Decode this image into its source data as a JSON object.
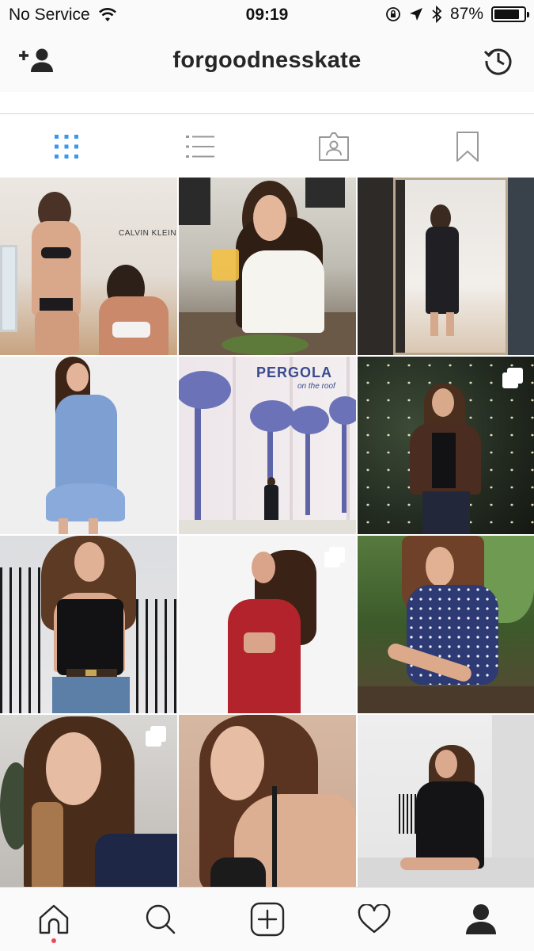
{
  "status_bar": {
    "carrier": "No Service",
    "time": "09:19",
    "battery_percent": "87%",
    "battery_level": 0.87,
    "icons": [
      "wifi-icon",
      "orientation-lock-icon",
      "location-arrow-icon",
      "bluetooth-icon",
      "battery-icon"
    ]
  },
  "header": {
    "username": "forgoodnesskate",
    "left_icon": "add-user-icon",
    "right_icon": "archive-history-icon"
  },
  "view_tabs": [
    {
      "id": "grid",
      "icon": "grid-icon",
      "active": true
    },
    {
      "id": "list",
      "icon": "list-icon",
      "active": false
    },
    {
      "id": "tagged",
      "icon": "tagged-photos-icon",
      "active": false
    },
    {
      "id": "saved",
      "icon": "bookmark-icon",
      "active": false
    }
  ],
  "posts": [
    {
      "scene": "two women in swimwear, Calvin Klein",
      "wall_text": "CALVIN KLEIN",
      "multi": false
    },
    {
      "scene": "woman at cafe with juice",
      "multi": false
    },
    {
      "scene": "mirror selfie in shop",
      "multi": false
    },
    {
      "scene": "blue polka dot wrap dress",
      "multi": false
    },
    {
      "scene": "palm tree mural wall",
      "wall_text": "PERGOLA",
      "wall_subtext": "on the roof",
      "multi": false
    },
    {
      "scene": "leather jacket with fairy lights",
      "multi": true
    },
    {
      "scene": "black cami and jeans",
      "multi": false
    },
    {
      "scene": "red dress over shoulder",
      "multi": true
    },
    {
      "scene": "navy floral wrap dress",
      "multi": false
    },
    {
      "scene": "close-up portrait",
      "multi": true
    },
    {
      "scene": "lace bralette portrait",
      "multi": false
    },
    {
      "scene": "black fringe jacket on steps",
      "multi": false
    }
  ],
  "bottom_nav": [
    {
      "id": "home",
      "icon": "home-icon",
      "active": true,
      "has_notification_dot": true
    },
    {
      "id": "search",
      "icon": "search-icon",
      "active": false
    },
    {
      "id": "new-post",
      "icon": "add-post-icon",
      "active": false
    },
    {
      "id": "activity",
      "icon": "heart-icon",
      "active": false
    },
    {
      "id": "profile",
      "icon": "profile-icon",
      "active": true
    }
  ],
  "colors": {
    "active_tab_blue": "#3897f0",
    "inactive_icon": "#999999",
    "notification_dot": "#ed4956"
  }
}
